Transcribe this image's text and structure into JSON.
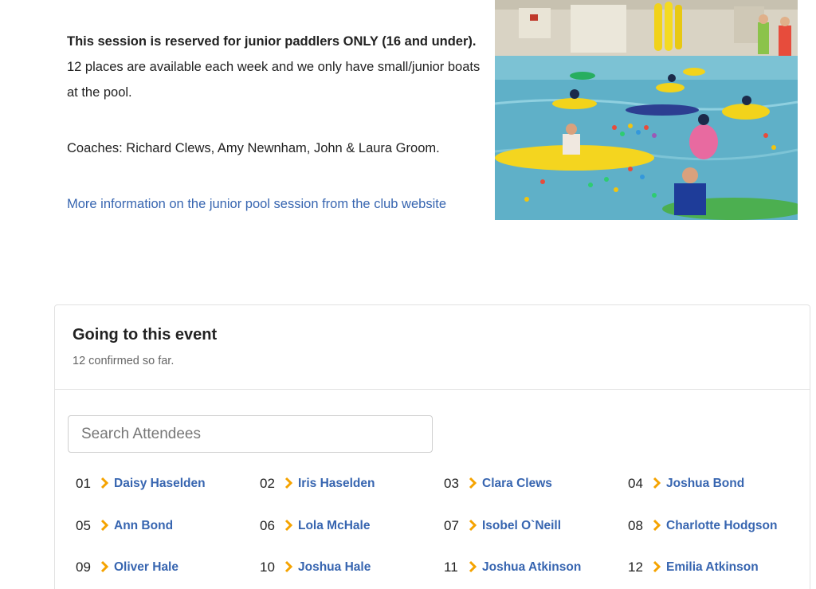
{
  "intro": {
    "bold_line": "This session is reserved for junior paddlers ONLY (16 and under).",
    "places_line": "12 places are available each week and we only have small/junior boats at the pool.",
    "coaches_line": "Coaches: Richard Clews, Amy Newnham, John & Laura Groom.",
    "more_link": "More information on the junior pool session from the club website"
  },
  "attendees_panel": {
    "title": "Going to this event",
    "subtitle": "12 confirmed so far.",
    "search_placeholder": "Search Attendees",
    "attendees": [
      {
        "num": "01",
        "name": "Daisy Haselden"
      },
      {
        "num": "02",
        "name": "Iris Haselden"
      },
      {
        "num": "03",
        "name": "Clara Clews"
      },
      {
        "num": "04",
        "name": "Joshua Bond"
      },
      {
        "num": "05",
        "name": "Ann Bond"
      },
      {
        "num": "06",
        "name": "Lola McHale"
      },
      {
        "num": "07",
        "name": "Isobel O`Neill"
      },
      {
        "num": "08",
        "name": "Charlotte Hodgson"
      },
      {
        "num": "09",
        "name": "Oliver Hale"
      },
      {
        "num": "10",
        "name": "Joshua Hale"
      },
      {
        "num": "11",
        "name": "Joshua Atkinson"
      },
      {
        "num": "12",
        "name": "Emilia Atkinson"
      }
    ]
  },
  "colors": {
    "link": "#3765b0",
    "chevron": "#f5a300",
    "pool_water": "#5fb0c8"
  },
  "icons": {
    "attendee_bullet": "chevron-right-icon"
  }
}
